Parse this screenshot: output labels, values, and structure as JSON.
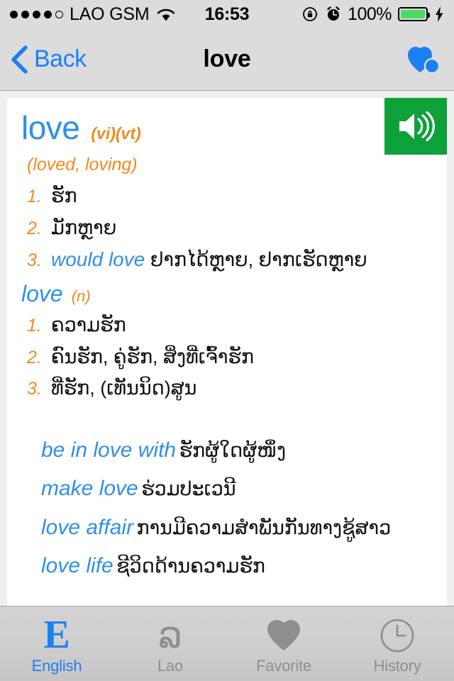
{
  "status_bar": {
    "signal_dots_filled": 4,
    "signal_dots_total": 5,
    "carrier": "LAO GSM",
    "wifi_icon": "wifi-icon",
    "time": "16:53",
    "rotation_lock_icon": "rotation-lock-icon",
    "alarm_icon": "alarm-clock-icon",
    "battery_percent": "100%",
    "battery_level": 100,
    "battery_color": "#4cd964",
    "charging_icon": "lightning-bolt-icon"
  },
  "nav_bar": {
    "back_label": "Back",
    "back_icon": "chevron-left-icon",
    "title": "love",
    "favorite_icon": "heart-plus-icon",
    "accent_color": "#1d80f2"
  },
  "entry": {
    "speaker_icon": "speaker-volume-icon",
    "speaker_button_color": "#0ea13a",
    "headword": "love",
    "pos": "(vi)(vt)",
    "inflections": "(loved, loving)",
    "verb_senses": [
      {
        "num": "1.",
        "en": "",
        "lo": "ຮັກ"
      },
      {
        "num": "2.",
        "en": "",
        "lo": "ມັກຫຼາຍ"
      },
      {
        "num": "3.",
        "en": "would love",
        "lo": "ຢາກໄດ້ຫຼາຍ, ຢາກເຮັດຫຼາຍ"
      }
    ],
    "noun_head": {
      "word": "love",
      "pos": "(n)"
    },
    "noun_senses": [
      {
        "num": "1.",
        "en": "",
        "lo": "ຄວາມຮັກ"
      },
      {
        "num": "2.",
        "en": "",
        "lo": "ຄົນຮັກ, ຄູ່ຮັກ, ສິ່ງທີ່ເຈົ້າຮັກ"
      },
      {
        "num": "3.",
        "en": "",
        "lo": "ທີ່ຮັກ, (ເທັນນິດ)ສູນ"
      }
    ],
    "phrases": [
      {
        "en": "be in love with",
        "lo": "ຮັກຜູ້ໃດຜູ້ໜຶ່ງ"
      },
      {
        "en": "make love",
        "lo": "ຮ່ວມປະເວນີ"
      },
      {
        "en": "love affair",
        "lo": "ການມີຄວາມສຳພັນກັນທາງຊູ້ສາວ"
      },
      {
        "en": "love life",
        "lo": "ຊີວິດດ້ານຄວາມຮັກ"
      }
    ]
  },
  "tab_bar": {
    "tabs": [
      {
        "label": "English",
        "icon": "letter-e-icon",
        "active": true
      },
      {
        "label": "Lao",
        "icon": "lao-letter-icon",
        "active": false
      },
      {
        "label": "Favorite",
        "icon": "heart-icon",
        "active": false
      },
      {
        "label": "History",
        "icon": "clock-icon",
        "active": false
      }
    ]
  }
}
